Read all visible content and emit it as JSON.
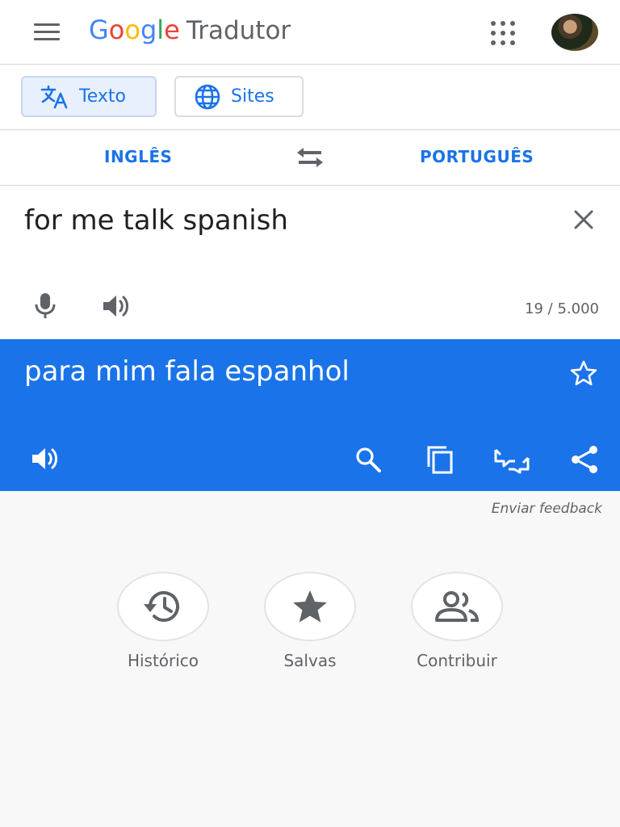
{
  "header": {
    "logo_letters": [
      {
        "char": "G",
        "color": "#4285f4"
      },
      {
        "char": "o",
        "color": "#ea4335"
      },
      {
        "char": "o",
        "color": "#fbbc05"
      },
      {
        "char": "g",
        "color": "#4285f4"
      },
      {
        "char": "l",
        "color": "#34a853"
      },
      {
        "char": "e",
        "color": "#ea4335"
      }
    ],
    "product_name": "Tradutor",
    "menu_icon": "hamburger-menu-icon",
    "apps_icon": "apps-grid-icon"
  },
  "modes": {
    "text_label": "Texto",
    "sites_label": "Sites",
    "active": "text"
  },
  "languages": {
    "source": "INGLÊS",
    "target": "PORTUGUÊS"
  },
  "input": {
    "text": "for me talk spanish",
    "counter": "19 / 5.000"
  },
  "output": {
    "text": "para mim fala espanhol"
  },
  "feedback_link": "Enviar feedback",
  "actions": {
    "history": "Histórico",
    "saved": "Salvas",
    "contribute": "Contribuir"
  },
  "colors": {
    "accent": "#1a73e8",
    "icon_gray": "#5f6368"
  }
}
